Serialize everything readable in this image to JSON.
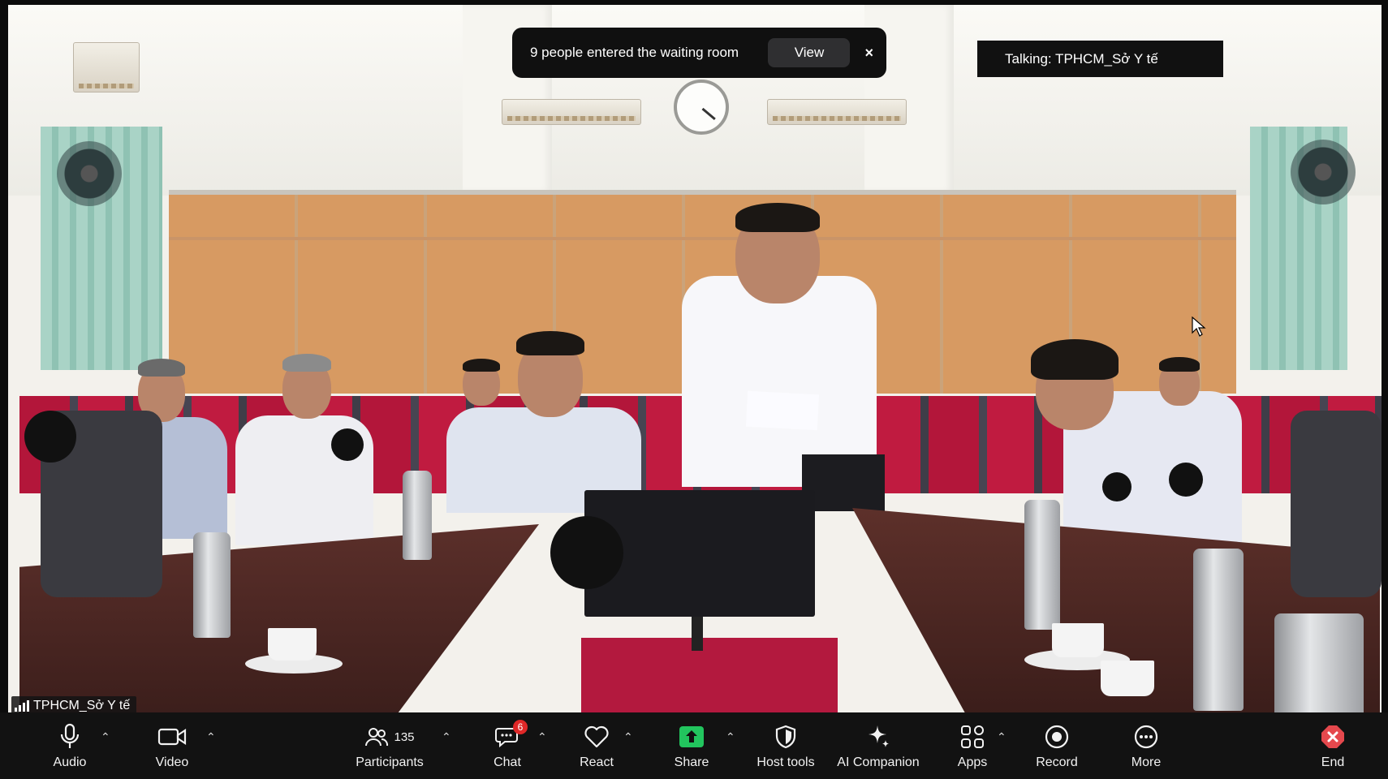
{
  "notification": {
    "message": "9 people entered the waiting room",
    "view_label": "View",
    "close_glyph": "×"
  },
  "talking_indicator": "Talking: TPHCM_Sở Y tế",
  "participant_name_tag": "TPHCM_Sở Y tế",
  "toolbar": {
    "audio": {
      "label": "Audio",
      "icon": "microphone-icon"
    },
    "video": {
      "label": "Video",
      "icon": "video-camera-icon"
    },
    "participants": {
      "label": "Participants",
      "count": "135",
      "icon": "participants-icon"
    },
    "chat": {
      "label": "Chat",
      "badge": "6",
      "icon": "chat-icon"
    },
    "react": {
      "label": "React",
      "icon": "heart-icon"
    },
    "share": {
      "label": "Share",
      "icon": "share-screen-icon",
      "accent": "#22c55e"
    },
    "host_tools": {
      "label": "Host tools",
      "icon": "shield-icon"
    },
    "ai_companion": {
      "label": "AI Companion",
      "icon": "sparkle-icon"
    },
    "apps": {
      "label": "Apps",
      "icon": "apps-icon"
    },
    "record": {
      "label": "Record",
      "icon": "record-icon"
    },
    "more": {
      "label": "More",
      "icon": "more-icon"
    },
    "end": {
      "label": "End",
      "icon": "end-icon",
      "accent": "#e5484d"
    }
  }
}
